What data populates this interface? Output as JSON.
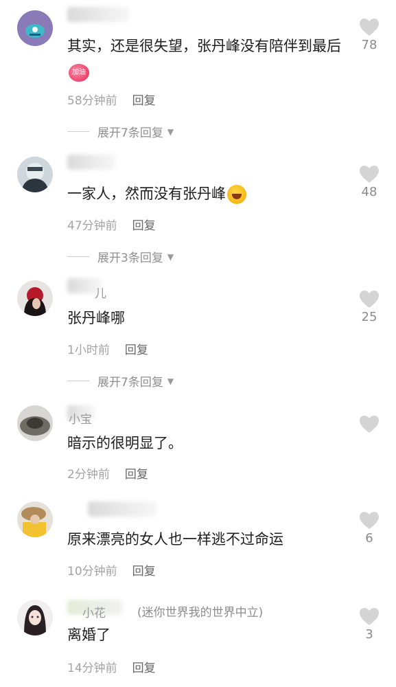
{
  "comments": [
    {
      "username": "",
      "text": "其实，还是很失望，张丹峰没有陪伴到最后",
      "time": "58分钟前",
      "reply": "回复",
      "expand": "展开7条回复",
      "likes": "78"
    },
    {
      "username": "",
      "text": "一家人，然而没有张丹峰",
      "time": "47分钟前",
      "reply": "回复",
      "expand": "展开3条回复",
      "likes": "48"
    },
    {
      "username": "儿",
      "text": "张丹峰哪",
      "time": "1小时前",
      "reply": "回复",
      "expand": "展开7条回复",
      "likes": "25"
    },
    {
      "username": "小宝",
      "text": "暗示的很明显了。",
      "time": "2分钟前",
      "reply": "回复",
      "likes": ""
    },
    {
      "username": "",
      "text": "原来漂亮的女人也一样逃不过命运",
      "time": "10分钟前",
      "reply": "回复",
      "likes": "6"
    },
    {
      "username": "小花",
      "author_tag": "(迷你世界我的世界中立)",
      "text": "离婚了",
      "time": "14分钟前",
      "reply": "回复",
      "likes": "3"
    }
  ],
  "badge_text": "加油"
}
